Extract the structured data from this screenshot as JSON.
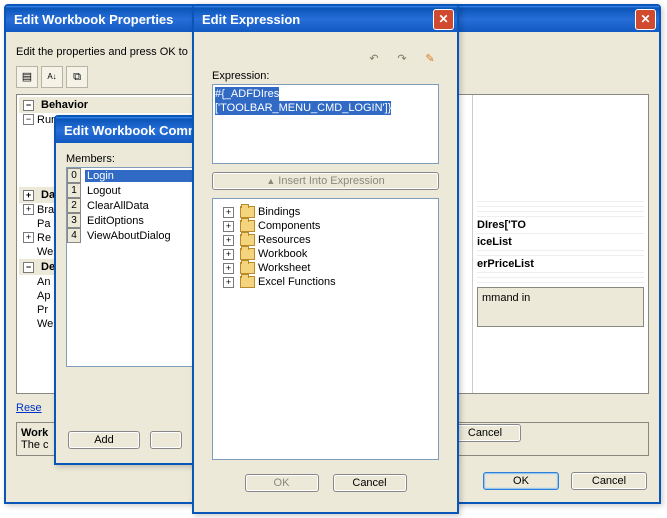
{
  "dlgA": {
    "title": "Edit Workbook Properties",
    "intro": "Edit the properties and press OK to",
    "behavior_header": "Behavior",
    "ribbon_row": "Runtime Ribbon Tab",
    "data_header": "Da",
    "rows_short": {
      "br": "Bra",
      "pa": "Pa",
      "re": "Re",
      "we": "We"
    },
    "design_header": "De",
    "rows_design": {
      "an": "An",
      "ap": "Ap",
      "pr": "Pr",
      "we": "We"
    },
    "reset_link": "Rese",
    "work_label": "Work",
    "work_desc": "The c",
    "ok": "OK",
    "cancel": "Cancel",
    "right_rows": {
      "r1": "DIres['TO",
      "r2": "iceList",
      "r3": "erPriceList"
    },
    "mmand_text": "mmand in",
    "cancel_mid": "Cancel"
  },
  "dlgB": {
    "title": "Edit Workbook Comm",
    "members_label": "Members:",
    "items": [
      {
        "n": "0",
        "label": "Login"
      },
      {
        "n": "1",
        "label": "Logout"
      },
      {
        "n": "2",
        "label": "ClearAllData"
      },
      {
        "n": "3",
        "label": "EditOptions"
      },
      {
        "n": "4",
        "label": "ViewAboutDialog"
      }
    ],
    "add": "Add"
  },
  "dlgC": {
    "title": "Edit Expression",
    "expression_label": "Expression:",
    "expr_line1": "#{_ADFDIres",
    "expr_line2": "['TOOLBAR_MENU_CMD_LOGIN']}",
    "insert_label": "Insert Into Expression",
    "tree": [
      "Bindings",
      "Components",
      "Resources",
      "Workbook",
      "Worksheet",
      "Excel Functions"
    ],
    "ok": "OK",
    "cancel": "Cancel",
    "icons": {
      "undo": "↶",
      "redo": "↷",
      "pencil": "✎",
      "up": "▲"
    }
  }
}
